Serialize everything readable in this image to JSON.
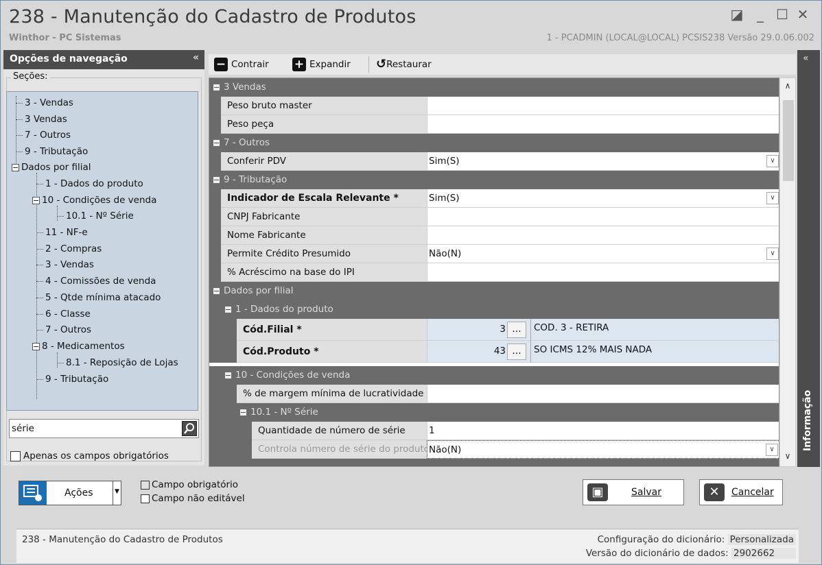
{
  "window": {
    "title": "238 - Manutenção do Cadastro de Produtos",
    "subtitle": "Winthor - PC Sistemas",
    "userinfo": "1 - PCADMIN (LOCAL@LOCAL)   PCSIS238  Versão  29.0.06.002"
  },
  "nav": {
    "header": "Opções de navegação",
    "sections_label": "Seções:",
    "items": [
      "3 - Vendas",
      "3 Vendas",
      "7 - Outros",
      "9 - Tributação",
      "Dados por filial",
      "1 - Dados do produto",
      "10 - Condições de venda",
      "10.1 - Nº Série",
      "11 - NF-e",
      "2 - Compras",
      "3 - Vendas",
      "4 - Comissões de venda",
      "5 - Qtde mínima atacado",
      "6 - Classe",
      "7 - Outros",
      "8 - Medicamentos",
      "8.1 -  Reposição de Lojas",
      "9 - Tributação"
    ],
    "search_value": "série",
    "only_required_label": "Apenas os campos obrigatórios"
  },
  "toolbar": {
    "collapse_label": "Contrair",
    "expand_label": "Expandir",
    "restore_label": "Restaurar"
  },
  "grid": {
    "cat_vendas": "3 Vendas",
    "peso_bruto_master": "Peso bruto master",
    "peso_peca": "Peso peça",
    "cat_outros": "7 - Outros",
    "conferir_pdv": "Conferir PDV",
    "conferir_pdv_value": "Sim(S)",
    "cat_tributacao": "9 - Tributação",
    "indicador_escala": "Indicador de Escala Relevante *",
    "indicador_escala_value": "Sim(S)",
    "cnpj_fabricante": "CNPJ Fabricante",
    "nome_fabricante": "Nome Fabricante",
    "credito_presumido": "Permite Crédito Presumido",
    "credito_presumido_value": "Não(N)",
    "acrescimo_ipi": "% Acréscimo na base do IPI",
    "cat_dados_filial": "Dados por filial",
    "cat_dados_produto": "1 - Dados do produto",
    "cod_filial": "Cód.Filial *",
    "cod_filial_value": "3",
    "cod_filial_desc": "COD. 3 - RETIRA",
    "cod_produto": "Cód.Produto *",
    "cod_produto_value": "43",
    "cod_produto_desc": "SO ICMS 12% MAIS NADA",
    "cat_condicoes": "10 - Condições de venda",
    "margem_minima": "% de margem mínima de lucratividade",
    "cat_serie": "10.1 - Nº Série",
    "qtd_num_serie": "Quantidade de número de série",
    "qtd_num_serie_value": "1",
    "controla_serie": "Controla número de série do produto",
    "controla_serie_value": "Não(N)",
    "ellipsis": "..."
  },
  "info_panel": {
    "label": "Informação"
  },
  "bottom": {
    "acoes_label": "Ações",
    "legend_required": "Campo obrigatório",
    "legend_readonly": "Campo não editável",
    "save_label": "Salvar",
    "cancel_label": "Cancelar"
  },
  "status": {
    "left": "238 - Manutenção do Cadastro de Produtos",
    "config_label": "Configuração do dicionário:",
    "config_value": "Personalizada",
    "version_label": "Versão do dicionário de dados:",
    "version_value": "2902662"
  }
}
